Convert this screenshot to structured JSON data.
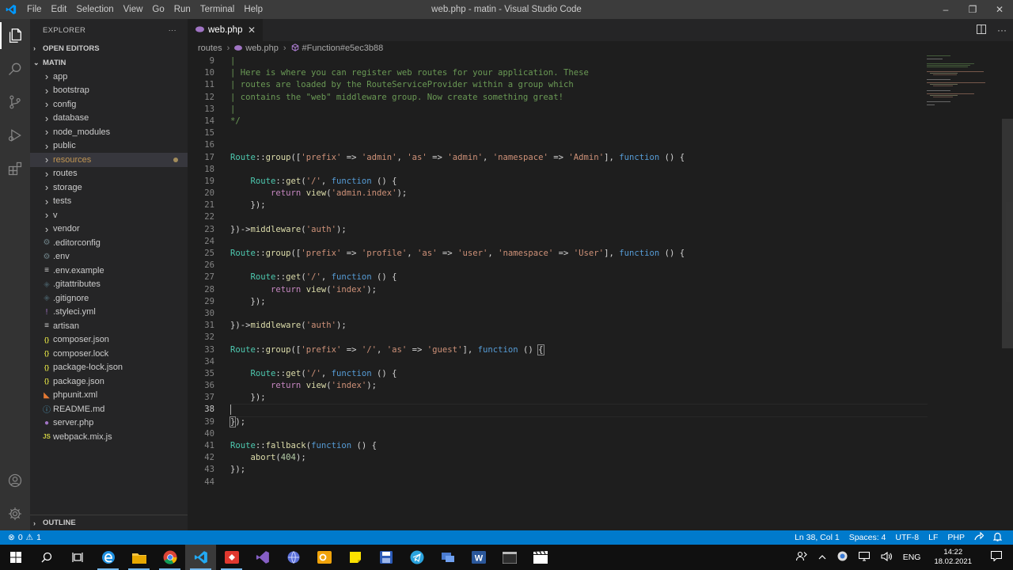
{
  "titlebar": {
    "menu": [
      "File",
      "Edit",
      "Selection",
      "View",
      "Go",
      "Run",
      "Terminal",
      "Help"
    ],
    "title": "web.php - matin - Visual Studio Code",
    "controls": [
      "–",
      "❐",
      "✕"
    ]
  },
  "sidebar": {
    "header": "EXPLORER",
    "more": "···",
    "open_editors": "OPEN EDITORS",
    "root": "MATIN",
    "items": [
      {
        "label": "app",
        "kind": "folder"
      },
      {
        "label": "bootstrap",
        "kind": "folder"
      },
      {
        "label": "config",
        "kind": "folder"
      },
      {
        "label": "database",
        "kind": "folder"
      },
      {
        "label": "node_modules",
        "kind": "folder"
      },
      {
        "label": "public",
        "kind": "folder"
      },
      {
        "label": "resources",
        "kind": "folder"
      },
      {
        "label": "routes",
        "kind": "folder"
      },
      {
        "label": "storage",
        "kind": "folder"
      },
      {
        "label": "tests",
        "kind": "folder"
      },
      {
        "label": "v",
        "kind": "folder"
      },
      {
        "label": "vendor",
        "kind": "folder"
      },
      {
        "label": ".editorconfig",
        "kind": "gear"
      },
      {
        "label": ".env",
        "kind": "gear"
      },
      {
        "label": ".env.example",
        "kind": "lines"
      },
      {
        "label": ".gitattributes",
        "kind": "git"
      },
      {
        "label": ".gitignore",
        "kind": "git"
      },
      {
        "label": ".styleci.yml",
        "kind": "yml"
      },
      {
        "label": "artisan",
        "kind": "lines"
      },
      {
        "label": "composer.json",
        "kind": "json"
      },
      {
        "label": "composer.lock",
        "kind": "json"
      },
      {
        "label": "package-lock.json",
        "kind": "json"
      },
      {
        "label": "package.json",
        "kind": "json"
      },
      {
        "label": "phpunit.xml",
        "kind": "rss"
      },
      {
        "label": "README.md",
        "kind": "info"
      },
      {
        "label": "server.php",
        "kind": "php"
      },
      {
        "label": "webpack.mix.js",
        "kind": "js"
      }
    ],
    "outline": "OUTLINE"
  },
  "editor": {
    "tab_label": "web.php",
    "tab_close": "✕",
    "breadcrumb": [
      "routes",
      "web.php",
      "#Function#e5ec3b88"
    ],
    "lines": [
      {
        "n": "9",
        "t": [
          [
            "c-com",
            "|"
          ]
        ]
      },
      {
        "n": "10",
        "t": [
          [
            "c-com",
            "| Here is where you can register web routes for your application. These"
          ]
        ]
      },
      {
        "n": "11",
        "t": [
          [
            "c-com",
            "| routes are loaded by the RouteServiceProvider within a group which"
          ]
        ]
      },
      {
        "n": "12",
        "t": [
          [
            "c-com",
            "| contains the \"web\" middleware group. Now create something great!"
          ]
        ]
      },
      {
        "n": "13",
        "t": [
          [
            "c-com",
            "|"
          ]
        ]
      },
      {
        "n": "14",
        "t": [
          [
            "c-com",
            "*/"
          ]
        ]
      },
      {
        "n": "15",
        "t": []
      },
      {
        "n": "16",
        "t": []
      },
      {
        "n": "17",
        "t": [
          [
            "c-cls",
            "Route"
          ],
          [
            "c-op",
            "::"
          ],
          [
            "c-fn",
            "group"
          ],
          [
            "c-op",
            "(["
          ],
          [
            "c-str",
            "'prefix'"
          ],
          [
            "c-op",
            " => "
          ],
          [
            "c-str",
            "'admin'"
          ],
          [
            "c-op",
            ", "
          ],
          [
            "c-str",
            "'as'"
          ],
          [
            "c-op",
            " => "
          ],
          [
            "c-str",
            "'admin'"
          ],
          [
            "c-op",
            ", "
          ],
          [
            "c-str",
            "'namespace'"
          ],
          [
            "c-op",
            " => "
          ],
          [
            "c-str",
            "'Admin'"
          ],
          [
            "c-op",
            "], "
          ],
          [
            "c-kw",
            "function"
          ],
          [
            "c-op",
            " () {"
          ]
        ]
      },
      {
        "n": "18",
        "t": []
      },
      {
        "n": "19",
        "t": [
          [
            "c-op",
            "    "
          ],
          [
            "c-cls",
            "Route"
          ],
          [
            "c-op",
            "::"
          ],
          [
            "c-fn",
            "get"
          ],
          [
            "c-op",
            "("
          ],
          [
            "c-str",
            "'/'"
          ],
          [
            "c-op",
            ", "
          ],
          [
            "c-kw",
            "function"
          ],
          [
            "c-op",
            " () {"
          ]
        ]
      },
      {
        "n": "20",
        "t": [
          [
            "c-op",
            "        "
          ],
          [
            "c-ctl",
            "return"
          ],
          [
            "c-op",
            " "
          ],
          [
            "c-fn",
            "view"
          ],
          [
            "c-op",
            "("
          ],
          [
            "c-str",
            "'admin.index'"
          ],
          [
            "c-op",
            ");"
          ]
        ]
      },
      {
        "n": "21",
        "t": [
          [
            "c-op",
            "    });"
          ]
        ]
      },
      {
        "n": "22",
        "t": []
      },
      {
        "n": "23",
        "t": [
          [
            "c-op",
            "})->"
          ],
          [
            "c-fn",
            "middleware"
          ],
          [
            "c-op",
            "("
          ],
          [
            "c-str",
            "'auth'"
          ],
          [
            "c-op",
            ");"
          ]
        ]
      },
      {
        "n": "24",
        "t": []
      },
      {
        "n": "25",
        "t": [
          [
            "c-cls",
            "Route"
          ],
          [
            "c-op",
            "::"
          ],
          [
            "c-fn",
            "group"
          ],
          [
            "c-op",
            "(["
          ],
          [
            "c-str",
            "'prefix'"
          ],
          [
            "c-op",
            " => "
          ],
          [
            "c-str",
            "'profile'"
          ],
          [
            "c-op",
            ", "
          ],
          [
            "c-str",
            "'as'"
          ],
          [
            "c-op",
            " => "
          ],
          [
            "c-str",
            "'user'"
          ],
          [
            "c-op",
            ", "
          ],
          [
            "c-str",
            "'namespace'"
          ],
          [
            "c-op",
            " => "
          ],
          [
            "c-str",
            "'User'"
          ],
          [
            "c-op",
            "], "
          ],
          [
            "c-kw",
            "function"
          ],
          [
            "c-op",
            " () {"
          ]
        ]
      },
      {
        "n": "26",
        "t": []
      },
      {
        "n": "27",
        "t": [
          [
            "c-op",
            "    "
          ],
          [
            "c-cls",
            "Route"
          ],
          [
            "c-op",
            "::"
          ],
          [
            "c-fn",
            "get"
          ],
          [
            "c-op",
            "("
          ],
          [
            "c-str",
            "'/'"
          ],
          [
            "c-op",
            ", "
          ],
          [
            "c-kw",
            "function"
          ],
          [
            "c-op",
            " () {"
          ]
        ]
      },
      {
        "n": "28",
        "t": [
          [
            "c-op",
            "        "
          ],
          [
            "c-ctl",
            "return"
          ],
          [
            "c-op",
            " "
          ],
          [
            "c-fn",
            "view"
          ],
          [
            "c-op",
            "("
          ],
          [
            "c-str",
            "'index'"
          ],
          [
            "c-op",
            ");"
          ]
        ]
      },
      {
        "n": "29",
        "t": [
          [
            "c-op",
            "    });"
          ]
        ]
      },
      {
        "n": "30",
        "t": []
      },
      {
        "n": "31",
        "t": [
          [
            "c-op",
            "})->"
          ],
          [
            "c-fn",
            "middleware"
          ],
          [
            "c-op",
            "("
          ],
          [
            "c-str",
            "'auth'"
          ],
          [
            "c-op",
            ");"
          ]
        ]
      },
      {
        "n": "32",
        "t": []
      },
      {
        "n": "33",
        "t": [
          [
            "c-cls",
            "Route"
          ],
          [
            "c-op",
            "::"
          ],
          [
            "c-fn",
            "group"
          ],
          [
            "c-op",
            "(["
          ],
          [
            "c-str",
            "'prefix'"
          ],
          [
            "c-op",
            " => "
          ],
          [
            "c-str",
            "'/'"
          ],
          [
            "c-op",
            ", "
          ],
          [
            "c-str",
            "'as'"
          ],
          [
            "c-op",
            " => "
          ],
          [
            "c-str",
            "'guest'"
          ],
          [
            "c-op",
            "], "
          ],
          [
            "c-kw",
            "function"
          ],
          [
            "c-op",
            " () "
          ],
          [
            "c-op brk",
            "{"
          ]
        ]
      },
      {
        "n": "34",
        "t": []
      },
      {
        "n": "35",
        "t": [
          [
            "c-op",
            "    "
          ],
          [
            "c-cls",
            "Route"
          ],
          [
            "c-op",
            "::"
          ],
          [
            "c-fn",
            "get"
          ],
          [
            "c-op",
            "("
          ],
          [
            "c-str",
            "'/'"
          ],
          [
            "c-op",
            ", "
          ],
          [
            "c-kw",
            "function"
          ],
          [
            "c-op",
            " () {"
          ]
        ]
      },
      {
        "n": "36",
        "t": [
          [
            "c-op",
            "        "
          ],
          [
            "c-ctl",
            "return"
          ],
          [
            "c-op",
            " "
          ],
          [
            "c-fn",
            "view"
          ],
          [
            "c-op",
            "("
          ],
          [
            "c-str",
            "'index'"
          ],
          [
            "c-op",
            ");"
          ]
        ]
      },
      {
        "n": "37",
        "t": [
          [
            "c-op",
            "    });"
          ]
        ]
      },
      {
        "n": "38",
        "t": [],
        "current": true
      },
      {
        "n": "39",
        "t": [
          [
            "c-op brk",
            "}"
          ],
          [
            "c-op",
            ");"
          ]
        ]
      },
      {
        "n": "40",
        "t": []
      },
      {
        "n": "41",
        "t": [
          [
            "c-cls",
            "Route"
          ],
          [
            "c-op",
            "::"
          ],
          [
            "c-fn",
            "fallback"
          ],
          [
            "c-op",
            "("
          ],
          [
            "c-kw",
            "function"
          ],
          [
            "c-op",
            " () {"
          ]
        ]
      },
      {
        "n": "42",
        "t": [
          [
            "c-op",
            "    "
          ],
          [
            "c-fn",
            "abort"
          ],
          [
            "c-op",
            "("
          ],
          [
            "c-num",
            "404"
          ],
          [
            "c-op",
            ");"
          ]
        ]
      },
      {
        "n": "43",
        "t": [
          [
            "c-op",
            "});"
          ]
        ]
      },
      {
        "n": "44",
        "t": []
      }
    ]
  },
  "statusbar": {
    "errors": "0",
    "warnings": "1",
    "position": "Ln 38, Col 1",
    "spaces": "Spaces: 4",
    "encoding": "UTF-8",
    "eol": "LF",
    "language": "PHP"
  },
  "taskbar": {
    "lang": "ENG",
    "time": "14:22",
    "date": "18.02.2021"
  },
  "colors": {
    "accent": "#007acc",
    "folder_chevron": "#cccccc",
    "modified": "#c09553"
  }
}
